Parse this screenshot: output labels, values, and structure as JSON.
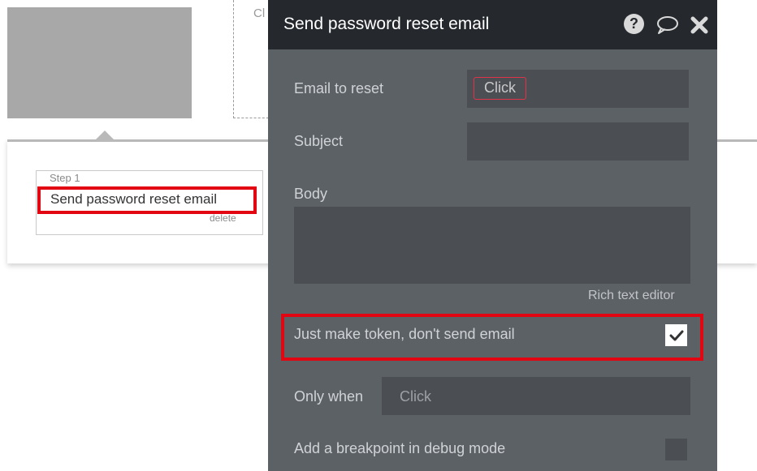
{
  "background": {
    "dashed_text": "Cl",
    "step": {
      "label": "Step 1",
      "title": "Send password reset email",
      "delete": "delete"
    }
  },
  "panel": {
    "title": "Send password reset email",
    "fields": {
      "email_label": "Email to reset",
      "email_chip": "Click",
      "subject_label": "Subject",
      "body_label": "Body",
      "rich_text_link": "Rich text editor",
      "token_label": "Just make token, don't send email",
      "token_checked": true,
      "only_when_label": "Only when",
      "only_when_chip": "Click",
      "breakpoint_label": "Add a breakpoint in debug mode",
      "breakpoint_checked": false
    }
  },
  "colors": {
    "panel_bg": "#5c6166",
    "header_bg": "#25292e",
    "highlight": "#e20613",
    "chip_border": "#e0334a"
  },
  "icons": [
    "help-icon",
    "comment-icon",
    "close-icon",
    "check-icon"
  ]
}
